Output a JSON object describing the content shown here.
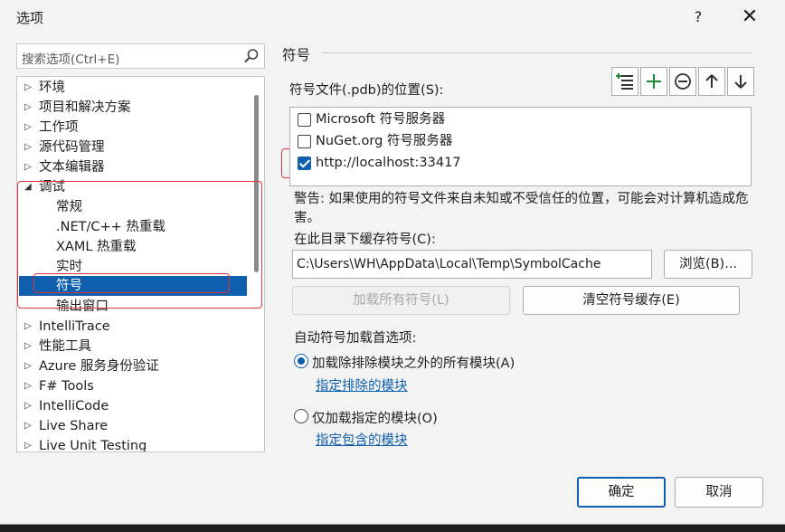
{
  "window": {
    "title": "选项",
    "help": "?",
    "close": "✕"
  },
  "search": {
    "placeholder": "搜索选项(Ctrl+E)"
  },
  "tree": {
    "items": [
      {
        "label": "环境",
        "arrow": "▷"
      },
      {
        "label": "项目和解决方案",
        "arrow": "▷"
      },
      {
        "label": "工作项",
        "arrow": "▷"
      },
      {
        "label": "源代码管理",
        "arrow": "▷"
      },
      {
        "label": "文本编辑器",
        "arrow": "▷"
      },
      {
        "label": "调试",
        "arrow": "◢"
      },
      {
        "label": "常规"
      },
      {
        "label": ".NET/C++ 热重载"
      },
      {
        "label": "XAML 热重载"
      },
      {
        "label": "实时"
      },
      {
        "label": "符号"
      },
      {
        "label": "输出窗口"
      },
      {
        "label": "IntelliTrace",
        "arrow": "▷"
      },
      {
        "label": "性能工具",
        "arrow": "▷"
      },
      {
        "label": "Azure 服务身份验证",
        "arrow": "▷"
      },
      {
        "label": "F# Tools",
        "arrow": "▷"
      },
      {
        "label": "IntelliCode",
        "arrow": "▷"
      },
      {
        "label": "Live Share",
        "arrow": "▷"
      },
      {
        "label": "Live Unit Testing",
        "arrow": "▷"
      }
    ]
  },
  "symbols": {
    "section_title": "符号",
    "locations_label": "符号文件(.pdb)的位置(S):",
    "locations": [
      {
        "label": "Microsoft 符号服务器",
        "checked": false
      },
      {
        "label": "NuGet.org 符号服务器",
        "checked": false
      },
      {
        "label": "http://localhost:33417",
        "checked": true
      }
    ],
    "warning": "警告: 如果使用的符号文件来自未知或不受信任的位置，可能会对计算机造成危害。",
    "cache_label": "在此目录下缓存符号(C):",
    "cache_path": "C:\\Users\\WH\\AppData\\Local\\Temp\\SymbolCache",
    "browse_button": "浏览(B)...",
    "load_all_button": "加载所有符号(L)",
    "clear_cache_button": "清空符号缓存(E)",
    "auto_load_label": "自动符号加载首选项:",
    "option_all_label": "加载除排除模块之外的所有模块(A)",
    "option_all_link": "指定排除的模块",
    "option_specified_label": "仅加载指定的模块(O)",
    "option_specified_link": "指定包含的模块"
  },
  "footer": {
    "ok_button": "确定",
    "cancel_button": "取消"
  },
  "colors": {
    "accent": "#0f5fae",
    "highlight_box": "#d9363e",
    "dialog_bg": "#f3f3f3"
  }
}
